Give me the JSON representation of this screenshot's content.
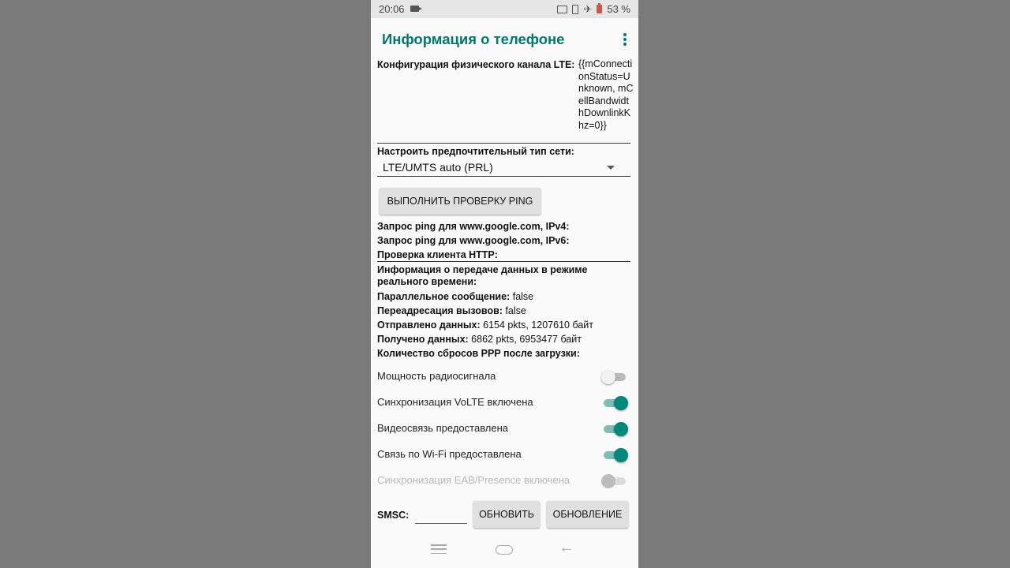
{
  "status_bar": {
    "time": "20:06",
    "battery": "53 %"
  },
  "app_bar": {
    "title": "Информация о телефоне"
  },
  "lte_config": {
    "label": "Конфигурация физического канала LTE:",
    "value": "{{mConnectionStatus=Unknown, mCellBandwidthDownlinkKhz=0}}"
  },
  "network_type": {
    "label": "Настроить предпочтительный тип сети:",
    "selected": "LTE/UMTS auto (PRL)"
  },
  "ping_button": "ВЫПОЛНИТЬ ПРОВЕРКУ PING",
  "ping_results": {
    "ipv4_label": "Запрос ping для www.google.com, IPv4:",
    "ipv6_label": "Запрос ping для www.google.com, IPv6:",
    "http_label": "Проверка клиента HTTP:"
  },
  "data_info": {
    "heading_line1": "Информация о передаче данных в режиме",
    "heading_line2": "реального времени:",
    "parallel_label": "Параллельное сообщение:",
    "parallel_value": "false",
    "forwarding_label": "Переадресация вызовов:",
    "forwarding_value": "false",
    "sent_label": "Отправлено данных:",
    "sent_value": "6154 pkts, 1207610 байт",
    "received_label": "Получено данных:",
    "received_value": "6862 pkts, 6953477 байт",
    "ppp_label": "Количество сбросов PPP после загрузки:"
  },
  "switches": [
    {
      "label": "Мощность радиосигнала",
      "state": "off"
    },
    {
      "label": "Синхронизация VoLTE включена",
      "state": "on"
    },
    {
      "label": "Видеосвязь предоставлена",
      "state": "on"
    },
    {
      "label": "Связь по Wi-Fi предоставлена",
      "state": "on"
    },
    {
      "label": "Синхронизация EAB/Presence включена",
      "state": "disabled"
    }
  ],
  "smsc": {
    "label": "SMSC:",
    "value": "",
    "refresh_button": "ОБНОВИТЬ",
    "update_button": "ОБНОВЛЕНИЕ"
  },
  "colors": {
    "accent": "#00796b",
    "switch_on": "#00897b",
    "background": "#fafafa",
    "outer_background": "#7a7a7a"
  },
  "icons": {
    "status_left": [
      "screen-record-icon"
    ],
    "status_right": [
      "cast-icon",
      "vibrate-icon",
      "airplane-icon",
      "battery-icon"
    ],
    "app_bar": [
      "overflow-menu-icon"
    ],
    "nav": [
      "recents-icon",
      "home-icon",
      "back-icon"
    ]
  }
}
